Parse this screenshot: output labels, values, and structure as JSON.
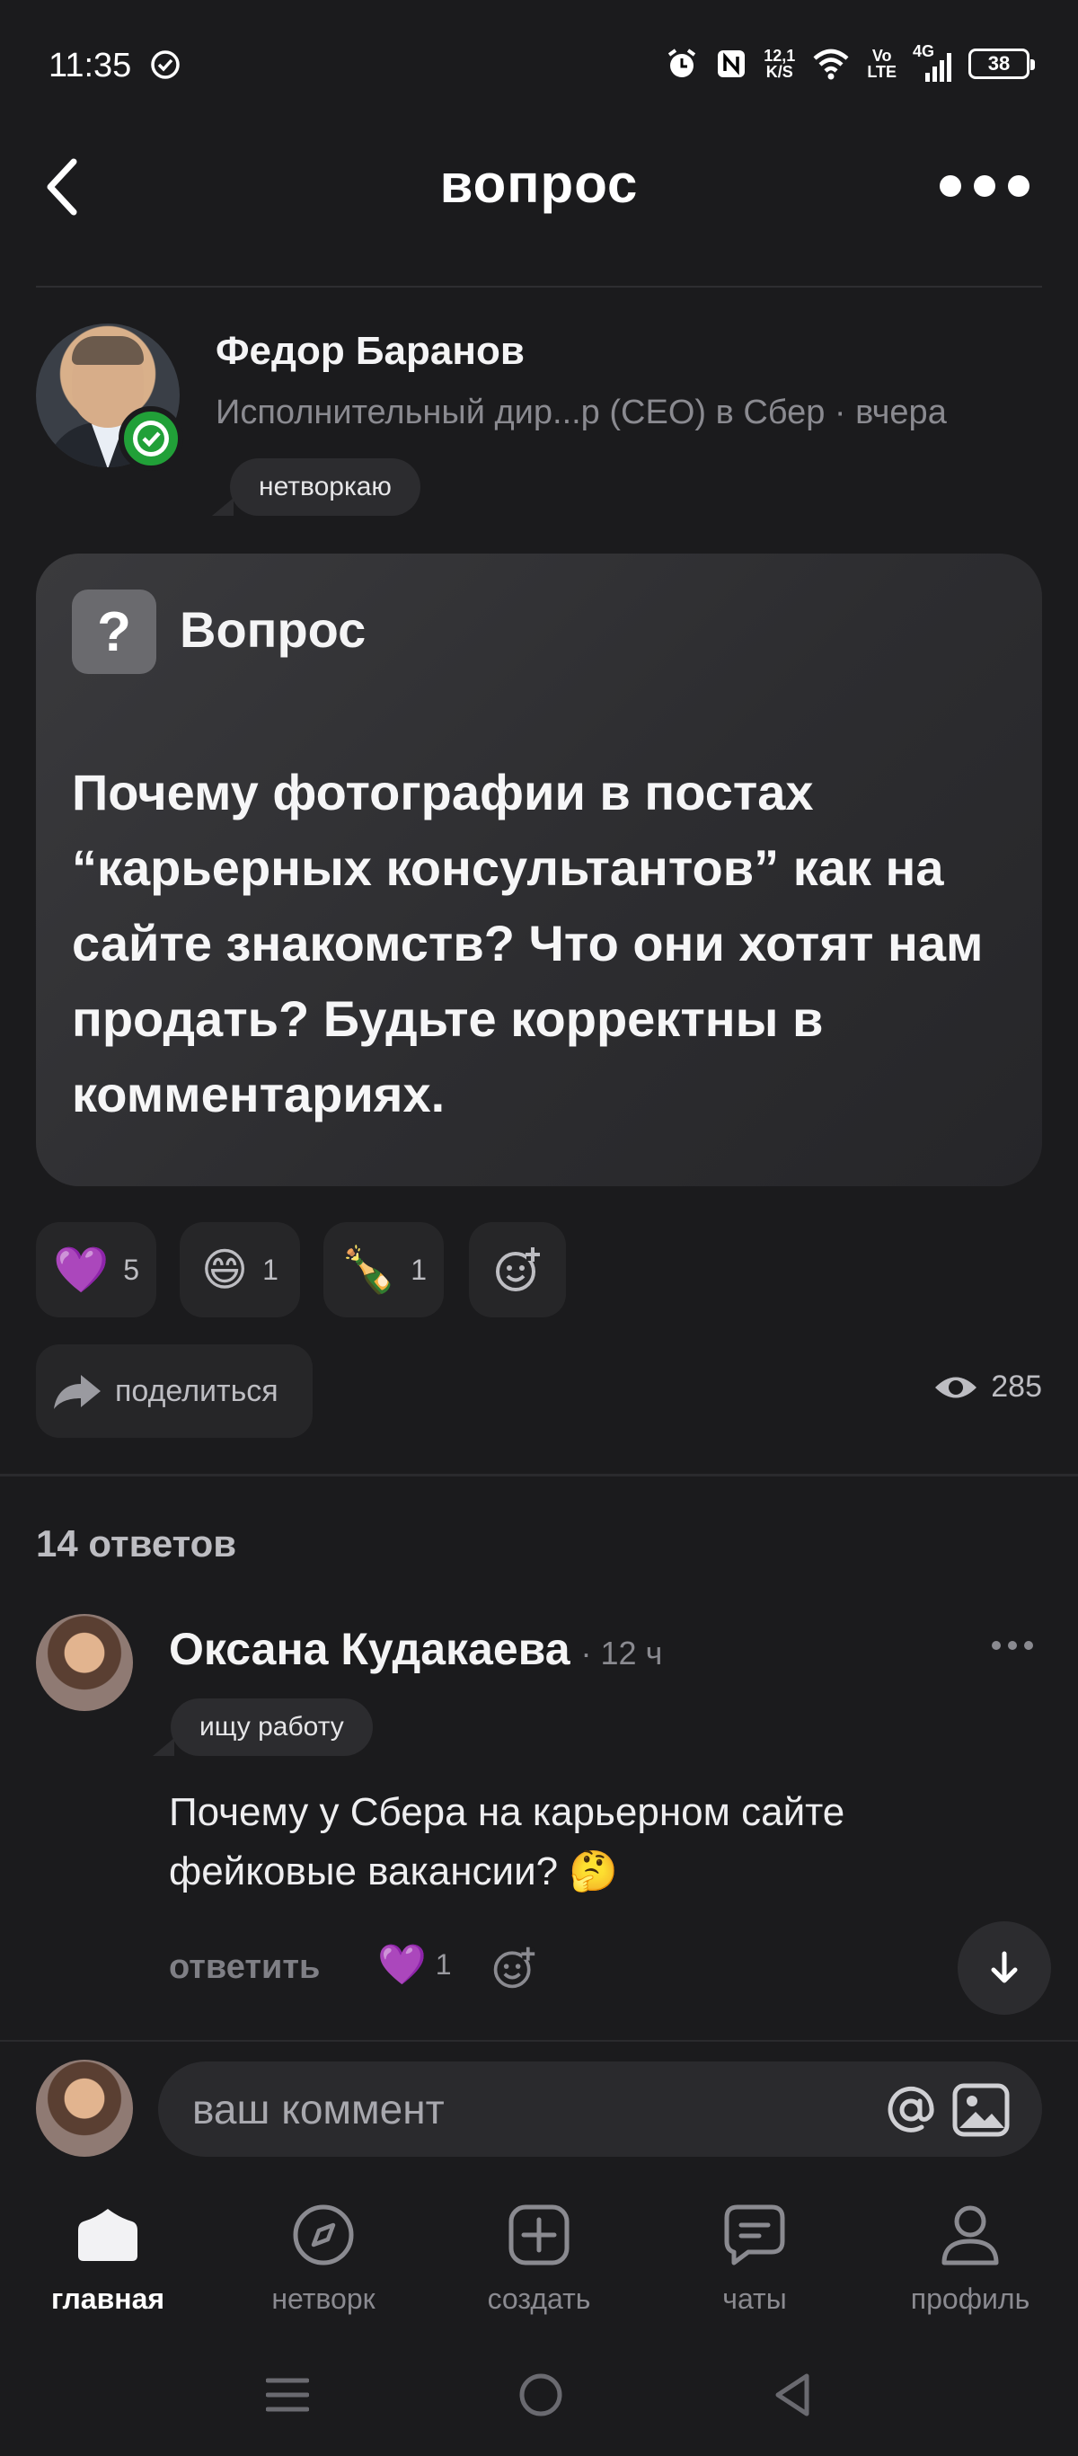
{
  "status_bar": {
    "time": "11:35",
    "net_speed_top": "12,1",
    "net_speed_bottom": "K/S",
    "volte_top": "Vo",
    "volte_bottom": "LTE",
    "network": "4G",
    "battery": "38"
  },
  "header": {
    "title": "вопрос"
  },
  "post": {
    "author_name": "Федор Баранов",
    "author_subtitle": "Исполнительный дир...р (CEO) в Сбер · вчера",
    "author_tag": "нетворкаю",
    "card_label": "Вопрос",
    "question_mark": "?",
    "question_text": "Почему фотографии в постах “карьерных консультантов” как на сайте знакомств? Что они хотят нам продать? Будьте корректны в комментариях.",
    "reactions": [
      {
        "emoji": "💜",
        "count": "5"
      },
      {
        "emoji": "😄",
        "count": "1"
      },
      {
        "emoji": "🍾",
        "count": "1"
      }
    ],
    "share_label": "поделиться",
    "views": "285"
  },
  "comments": {
    "count_label": "14 ответов",
    "items": [
      {
        "author": "Оксана Кудакаева",
        "time": "· 12 ч",
        "tag": "ищу работу",
        "text": "Почему у Сбера на карьерном сайте фейковые вакансии? 🤔",
        "reply_label": "ответить",
        "like_emoji": "💜",
        "like_count": "1"
      }
    ]
  },
  "compose": {
    "placeholder": "ваш коммент"
  },
  "tabs": [
    {
      "label": "главная",
      "icon": "home-icon",
      "active": true
    },
    {
      "label": "нетворк",
      "icon": "compass-icon",
      "active": false
    },
    {
      "label": "создать",
      "icon": "plus-square-icon",
      "active": false
    },
    {
      "label": "чаты",
      "icon": "chat-icon",
      "active": false
    },
    {
      "label": "профиль",
      "icon": "person-icon",
      "active": false
    }
  ],
  "colors": {
    "background": "#1b1b1d",
    "card": "#2d2d30",
    "verified": "#21a038",
    "muted_text": "#8a8a90"
  }
}
